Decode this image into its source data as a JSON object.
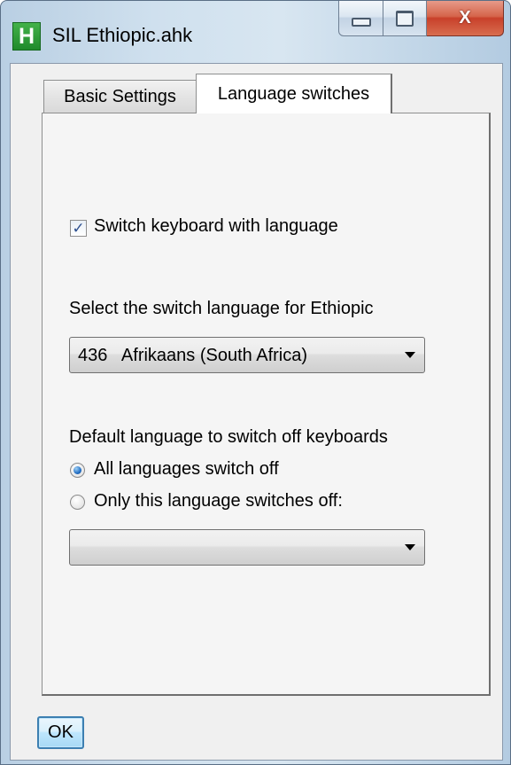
{
  "window": {
    "icon_letter": "H",
    "title": "SIL Ethiopic.ahk",
    "close_glyph": "X"
  },
  "tabs": [
    {
      "label": "Basic Settings",
      "selected": false
    },
    {
      "label": "Language switches",
      "selected": true
    }
  ],
  "switch_keyboard": {
    "label": "Switch keyboard with language",
    "checked": true
  },
  "switch_language": {
    "label": "Select the switch language for Ethiopic",
    "value": "436   Afrikaans (South Africa)"
  },
  "default_language": {
    "label": "Default language to switch off keyboards",
    "options": [
      {
        "label": "All languages switch off",
        "selected": true
      },
      {
        "label": "Only this language switches off:",
        "selected": false
      }
    ],
    "dropdown_value": ""
  },
  "buttons": {
    "ok": "OK"
  },
  "colors": {
    "accent": "#3c7fb1",
    "close_button": "#c8402a",
    "panel_background": "#f0f0f0"
  }
}
